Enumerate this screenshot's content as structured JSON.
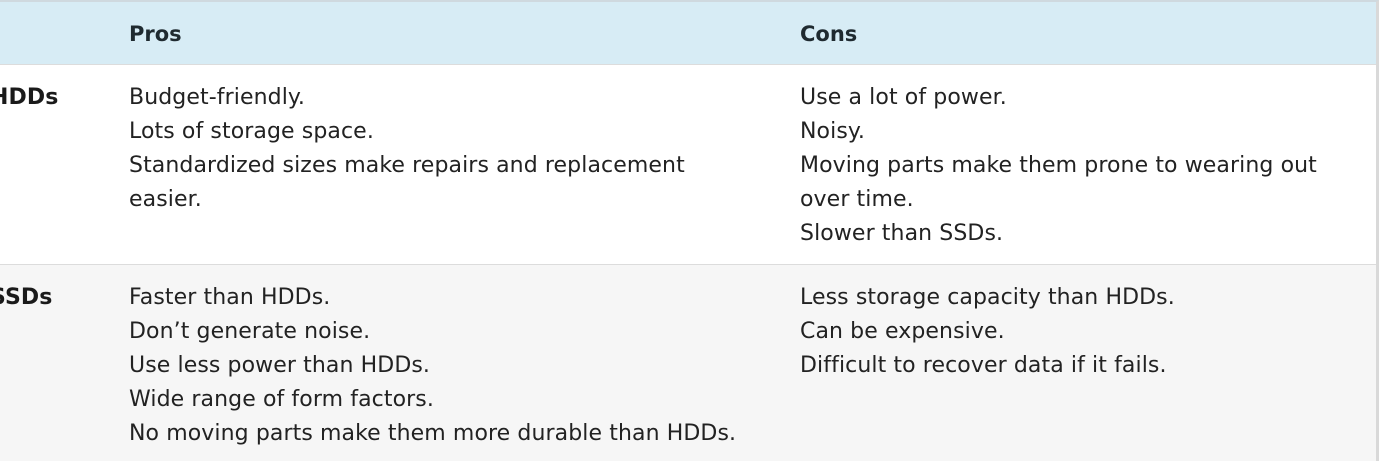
{
  "header": {
    "label": "",
    "pros": "Pros",
    "cons": "Cons"
  },
  "rows": [
    {
      "label": "HDDs",
      "pros": [
        "Budget-friendly.",
        "Lots of storage space.",
        "Standardized sizes make repairs and replacement easier."
      ],
      "cons": [
        "Use a lot of power.",
        "Noisy.",
        "Moving parts make them prone to wearing out over time.",
        "Slower than SSDs."
      ]
    },
    {
      "label": "SSDs",
      "pros": [
        "Faster than HDDs.",
        "Don’t generate noise.",
        "Use less power than HDDs.",
        "Wide range of form factors.",
        "No moving parts make them more durable than HDDs."
      ],
      "cons": [
        "Less storage capacity than HDDs.",
        "Can be expensive.",
        "Difficult to recover data if it fails."
      ]
    }
  ]
}
